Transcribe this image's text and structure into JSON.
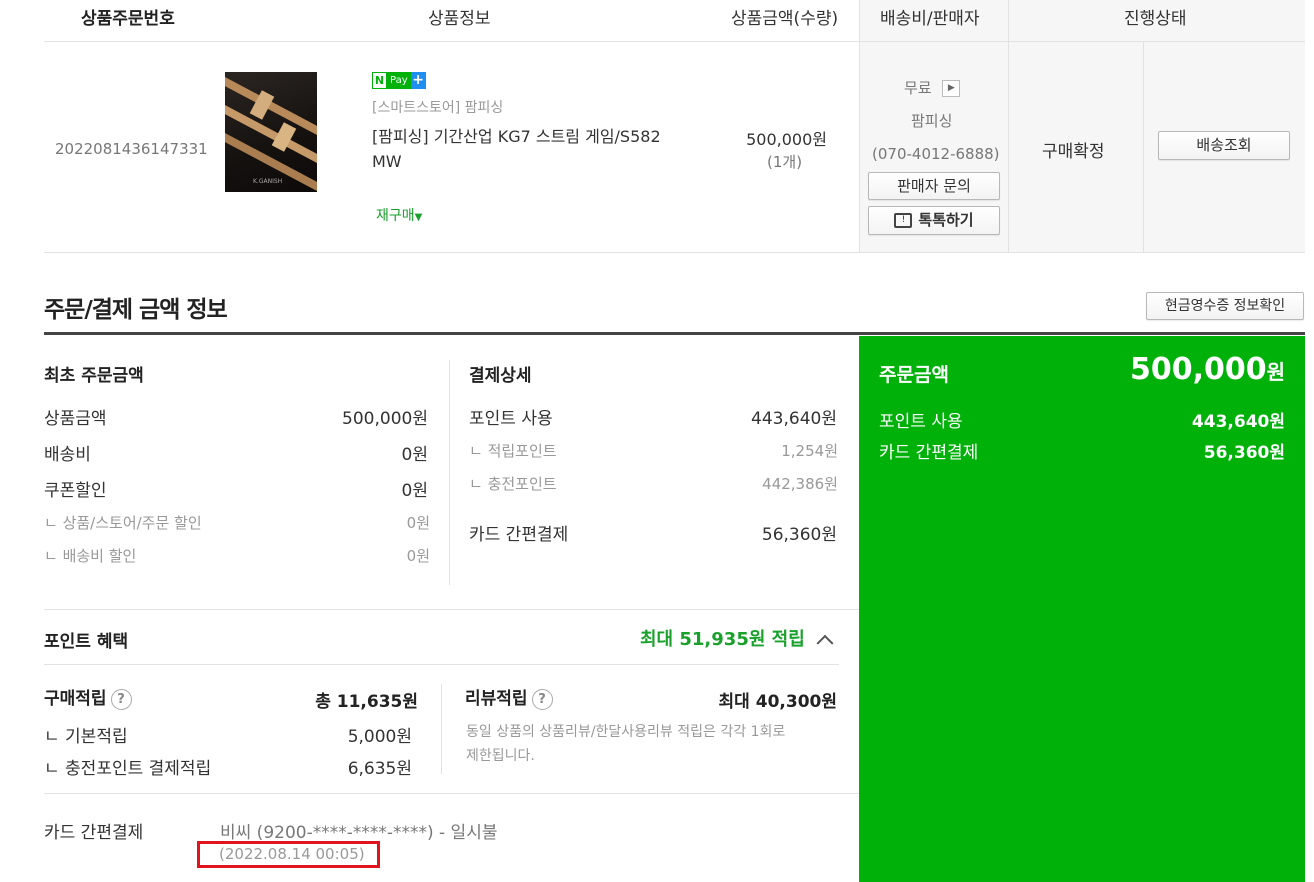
{
  "table_header": {
    "order_no": "상품주문번호",
    "product_info": "상품정보",
    "amount_qty": "상품금액(수량)",
    "shipping_seller": "배송비/판매자",
    "status": "진행상태"
  },
  "order_item": {
    "order_number": "2022081436147331",
    "npay_badge": "Pay",
    "store_label": "[스마트스토어] 팜피싱",
    "product_name_line1": "[팜피싱] 기간산업 KG7 스트림 게임/S582",
    "product_name_line2": "MW",
    "rebuy": "재구매",
    "price": "500,000원",
    "quantity": "(1개)",
    "shipping_fee": "무료",
    "seller_name": "팜피싱",
    "seller_phone": "(070-4012-6888)",
    "seller_inquiry_button": "판매자 문의",
    "talktalk_button": "톡톡하기",
    "status": "구매확정",
    "tracking_button": "배송조회",
    "product_image_text": "K.GANISH"
  },
  "payment_section": {
    "title": "주문/결제 금액 정보",
    "receipt_button": "현금영수증 정보확인"
  },
  "initial_order": {
    "heading": "최초 주문금액",
    "rows": [
      {
        "label": "상품금액",
        "value": "500,000원"
      },
      {
        "label": "배송비",
        "value": "0원"
      },
      {
        "label": "쿠폰할인",
        "value": "0원"
      }
    ],
    "sub_rows": [
      {
        "label": "ㄴ 상품/스토어/주문 할인",
        "value": "0원"
      },
      {
        "label": "ㄴ 배송비 할인",
        "value": "0원"
      }
    ]
  },
  "payment_detail": {
    "heading": "결제상세",
    "point_label": "포인트 사용",
    "point_value": "443,640원",
    "earned_label": "ㄴ 적립포인트",
    "earned_value": "1,254원",
    "charged_label": "ㄴ 충전포인트",
    "charged_value": "442,386원",
    "card_label": "카드 간편결제",
    "card_value": "56,360원"
  },
  "summary": {
    "order_amount_label": "주문금액",
    "order_amount_value": "500,000",
    "won": "원",
    "point_label": "포인트 사용",
    "point_value": "443,640원",
    "card_label": "카드 간편결제",
    "card_value": "56,360원"
  },
  "points_benefit": {
    "heading": "포인트 혜택",
    "max_earn": "최대 51,935원 적립",
    "purchase_label": "구매적립",
    "purchase_total": "총 11,635원",
    "basic_label": "ㄴ 기본적립",
    "basic_value": "5,000원",
    "charge_label": "ㄴ 충전포인트 결제적립",
    "charge_value": "6,635원",
    "review_label": "리뷰적립",
    "review_value": "최대 40,300원",
    "review_note_line1": "동일 상품의 상품리뷰/한달사용리뷰 적립은 각각 1회로",
    "review_note_line2": "제한됩니다."
  },
  "card_payment": {
    "label": "카드 간편결제",
    "detail": "비씨 (9200-****-****-****) - 일시불",
    "datetime": "(2022.08.14 00:05)"
  },
  "colors": {
    "accent_green": "#00b10a",
    "text_green": "#19a12c",
    "highlight_red": "#e0141e"
  }
}
